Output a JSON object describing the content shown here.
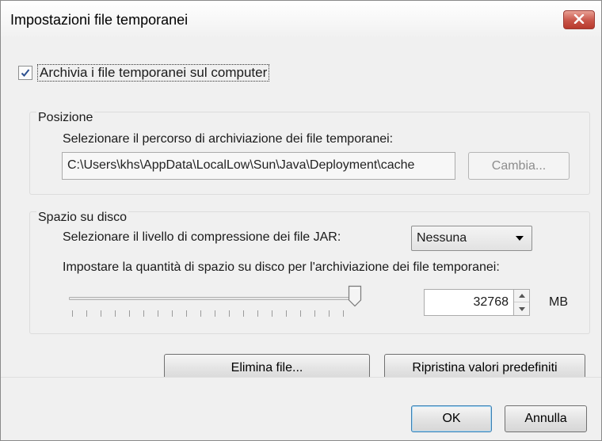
{
  "window": {
    "title": "Impostazioni file temporanei",
    "close_icon": "close-icon"
  },
  "storage": {
    "keep_files_label": "Archivia i file temporanei sul computer",
    "keep_files_checked": true
  },
  "position": {
    "group_title": "Posizione",
    "instruction": "Selezionare il percorso di archiviazione dei file temporanei:",
    "path_value": "C:\\Users\\khs\\AppData\\LocalLow\\Sun\\Java\\Deployment\\cache",
    "change_button": "Cambia..."
  },
  "disk_space": {
    "group_title": "Spazio su disco",
    "compression_label": "Selezionare il livello di compressione dei file JAR:",
    "compression_value": "Nessuna",
    "space_label": "Impostare la quantità di spazio su disco per l'archiviazione dei file temporanei:",
    "slider_level": 1.0,
    "space_value": "32768",
    "unit": "MB"
  },
  "actions": {
    "delete_button": "Elimina file...",
    "restore_button": "Ripristina valori predefiniti"
  },
  "footer": {
    "ok_button": "OK",
    "cancel_button": "Annulla"
  },
  "colors": {
    "close_button": "#c85448",
    "default_button_border": "#3c7fb1",
    "window_bg": "#f0f0f0"
  }
}
